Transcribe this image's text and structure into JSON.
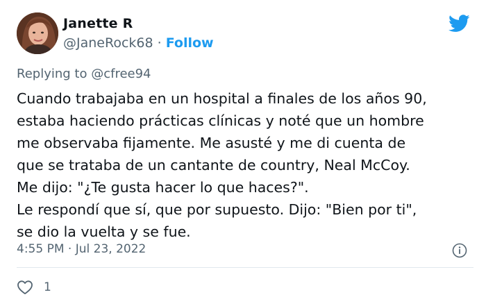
{
  "author": {
    "display_name": "Janette R",
    "handle": "@JaneRock68",
    "separator": "·",
    "follow_label": "Follow"
  },
  "icons": {
    "brand": "twitter-bird-icon",
    "info": "info-icon",
    "like": "heart-icon"
  },
  "colors": {
    "accent": "#1d9bf0",
    "text": "#0f1419",
    "muted": "#536471"
  },
  "reply": {
    "prefix": "Replying to",
    "mention": "@cfree94"
  },
  "tweet": {
    "lines": [
      "Cuando trabajaba en un hospital a finales de los años 90,",
      "estaba haciendo prácticas clínicas y noté que un hombre",
      "me observaba fijamente. Me asusté y me di cuenta de",
      "que se trataba de un cantante de country, Neal McCoy.",
      "Me dijo: \"¿Te gusta hacer lo que haces?\".",
      "Le respondí que sí, que por supuesto. Dijo: \"Bien por ti\",",
      "se dio la vuelta y se fue."
    ],
    "timestamp": "4:55 PM · Jul 23, 2022",
    "like_count": "1"
  }
}
